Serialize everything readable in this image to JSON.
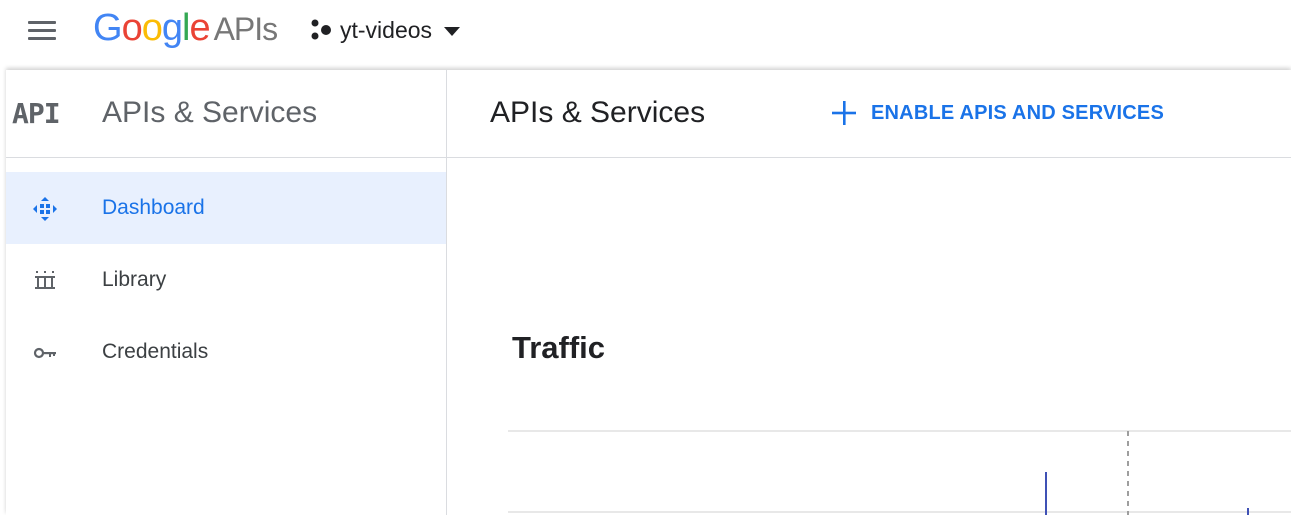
{
  "topbar": {
    "logo": {
      "google": "Google",
      "apis": "APIs"
    },
    "project": {
      "name": "yt-videos"
    }
  },
  "sidebar": {
    "badge": "API",
    "title": "APIs & Services",
    "items": [
      {
        "label": "Dashboard",
        "icon": "dashboard-icon",
        "active": true
      },
      {
        "label": "Library",
        "icon": "library-icon",
        "active": false
      },
      {
        "label": "Credentials",
        "icon": "key-icon",
        "active": false
      }
    ]
  },
  "main": {
    "title": "APIs & Services",
    "enable_button": "ENABLE APIS AND SERVICES",
    "traffic_title": "Traffic"
  },
  "colors": {
    "accent": "#1a73e8",
    "active_bg": "#e8f0fe",
    "google_blue": "#4285f4",
    "google_red": "#ea4335",
    "google_yellow": "#fbbc05",
    "google_green": "#34a853"
  }
}
